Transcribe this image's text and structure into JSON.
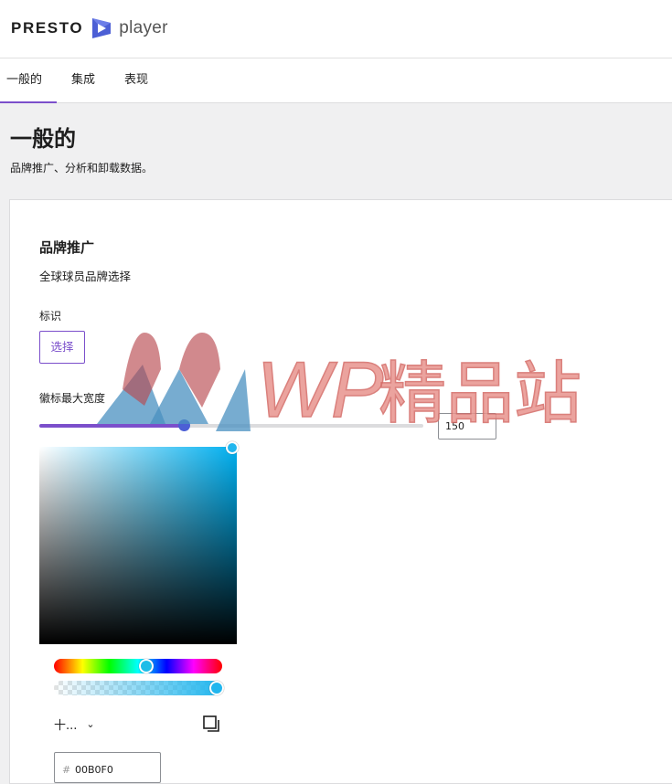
{
  "header": {
    "logo_word": "PRESTO",
    "logo_player": "player",
    "brand_color": "#4c5fd5"
  },
  "tabs": [
    {
      "label": "一般的",
      "active": true
    },
    {
      "label": "集成",
      "active": false
    },
    {
      "label": "表现",
      "active": false
    }
  ],
  "page": {
    "title": "一般的",
    "subtitle": "品牌推广、分析和卸载数据。"
  },
  "branding": {
    "title": "品牌推广",
    "description": "全球球员品牌选择",
    "logo_label": "标识",
    "select_button": "选择",
    "max_width_label": "徽标最大宽度",
    "max_width_value": "150",
    "range_fraction": 0.375,
    "accent_color": "#7b4fcb"
  },
  "color_picker": {
    "hue_fraction": 0.55,
    "alpha_fraction": 0.97,
    "format_label": "十...",
    "hex_value": "00B0F0",
    "color": "#21b6ee"
  },
  "watermark": {
    "text": "WP精品站"
  },
  "icons": {
    "logo_mark": "presto-logo-icon",
    "chevron": "chevron-down-icon",
    "copy": "copy-icon"
  }
}
